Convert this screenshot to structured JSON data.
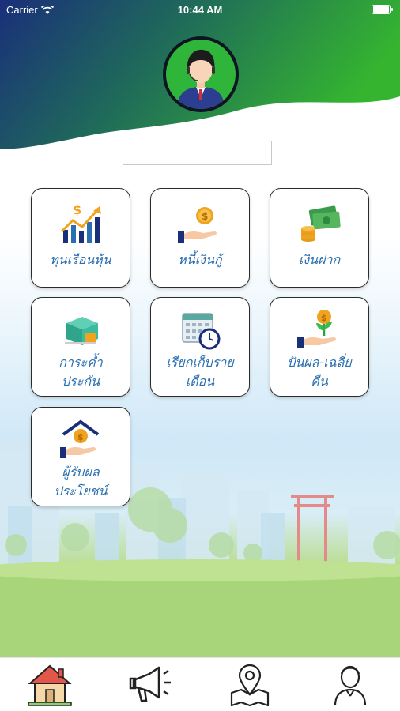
{
  "status_bar": {
    "carrier": "Carrier",
    "time": "10:44 AM"
  },
  "header": {
    "avatar_icon": "user-avatar-icon",
    "name_value": ""
  },
  "menu": {
    "items": [
      {
        "label": "ทุนเรือนหุ้น",
        "icon": "stock-chart-icon"
      },
      {
        "label": "หนี้เงินกู้",
        "icon": "loan-hand-coin-icon"
      },
      {
        "label": "เงินฝาก",
        "icon": "money-deposit-icon"
      },
      {
        "label": "การะค้ำประกัน",
        "line1": "การะค้ำ",
        "line2": "ประกัน",
        "icon": "guarantee-box-icon"
      },
      {
        "label": "เรียกเก็บรายเดือน",
        "line1": "เรียกเก็บราย",
        "line2": "เดือน",
        "icon": "calendar-clock-icon"
      },
      {
        "label": "ปันผล-เฉลี่ยคืน",
        "line1": "ปันผล-เฉลี่ย",
        "line2": "คืน",
        "icon": "dividend-plant-icon"
      },
      {
        "label": "ผู้รับผลประโยชน์",
        "line1": "ผู้รับผล",
        "line2": "ประโยชน์",
        "icon": "beneficiary-house-icon"
      }
    ]
  },
  "tab_bar": {
    "items": [
      {
        "icon": "home-icon"
      },
      {
        "icon": "megaphone-icon"
      },
      {
        "icon": "map-pin-icon"
      },
      {
        "icon": "profile-icon"
      }
    ]
  },
  "colors": {
    "header_gradient_start": "#1a2f7a",
    "header_gradient_end": "#35b52f",
    "label_blue": "#2a6fb0",
    "avatar_green": "#2fb53a"
  }
}
